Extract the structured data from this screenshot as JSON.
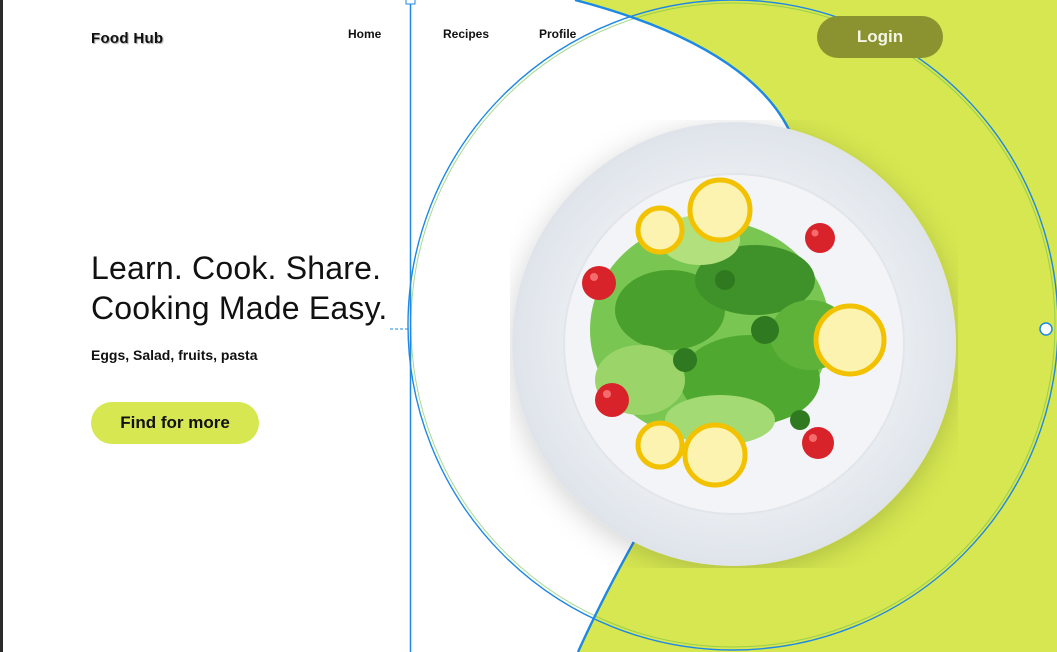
{
  "brand": {
    "name": "Food Hub"
  },
  "nav": {
    "home": "Home",
    "recipes": "Recipes",
    "profile": "Profile"
  },
  "header": {
    "login_label": "Login"
  },
  "hero": {
    "line1": "Learn. Cook. Share.",
    "line2": "Cooking Made Easy.",
    "subtitle": "Eggs, Salad, fruits, pasta",
    "cta_label": "Find for more"
  },
  "colors": {
    "accent_lime": "#d6e751",
    "login_olive": "#8a9330",
    "guide_blue": "#1e88e5"
  },
  "image": {
    "subject": "salad-plate"
  }
}
